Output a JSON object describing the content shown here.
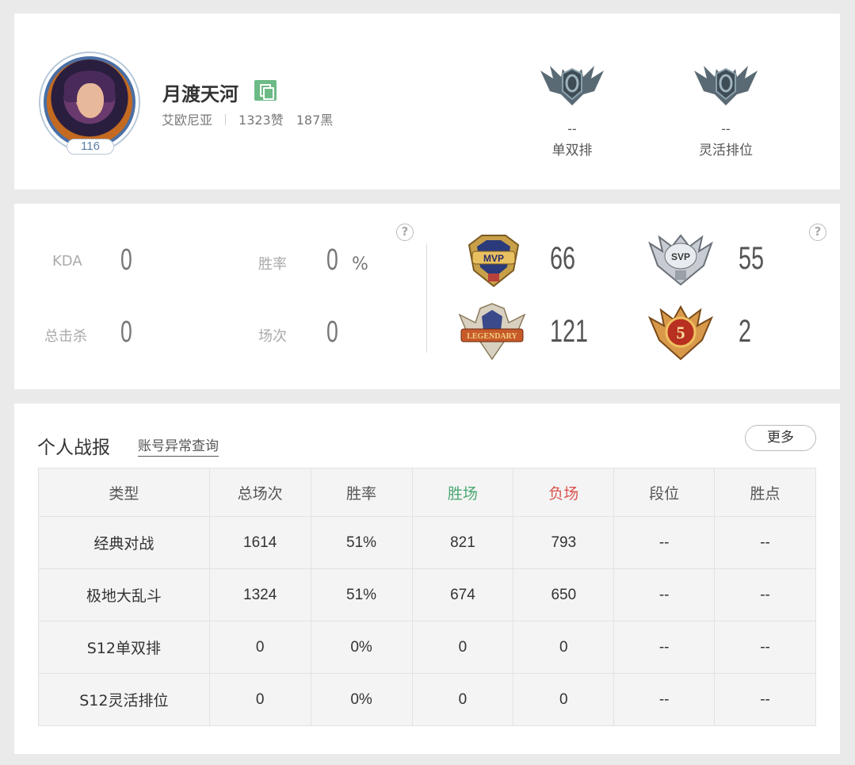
{
  "profile": {
    "name": "月渡天河",
    "server": "艾欧尼亚",
    "likes": "1323赞",
    "dislikes": "187黑",
    "level": "116",
    "ranks": [
      {
        "value": "--",
        "label": "单双排"
      },
      {
        "value": "--",
        "label": "灵活排位"
      }
    ]
  },
  "stats": {
    "kda_label": "KDA",
    "kda_value": "0",
    "winrate_label": "胜率",
    "winrate_value": "0",
    "winrate_unit": "%",
    "kills_label": "总击杀",
    "kills_value": "0",
    "games_label": "场次",
    "games_value": "0",
    "help": "?",
    "honors": [
      {
        "badge": "MVP",
        "value": "66"
      },
      {
        "badge": "SVP",
        "value": "55"
      },
      {
        "badge": "LEGENDARY",
        "value": "121"
      },
      {
        "badge": "5",
        "value": "2"
      }
    ]
  },
  "report": {
    "title": "个人战报",
    "link": "账号异常查询",
    "more": "更多",
    "headers": [
      "类型",
      "总场次",
      "胜率",
      "胜场",
      "负场",
      "段位",
      "胜点"
    ],
    "rows": [
      [
        "经典对战",
        "1614",
        "51%",
        "821",
        "793",
        "--",
        "--"
      ],
      [
        "极地大乱斗",
        "1324",
        "51%",
        "674",
        "650",
        "--",
        "--"
      ],
      [
        "S12单双排",
        "0",
        "0%",
        "0",
        "0",
        "--",
        "--"
      ],
      [
        "S12灵活排位",
        "0",
        "0%",
        "0",
        "0",
        "--",
        "--"
      ]
    ]
  },
  "colors": {
    "win": "#4aa872",
    "loss": "#d9534f",
    "copy_button": "#6cba86"
  }
}
